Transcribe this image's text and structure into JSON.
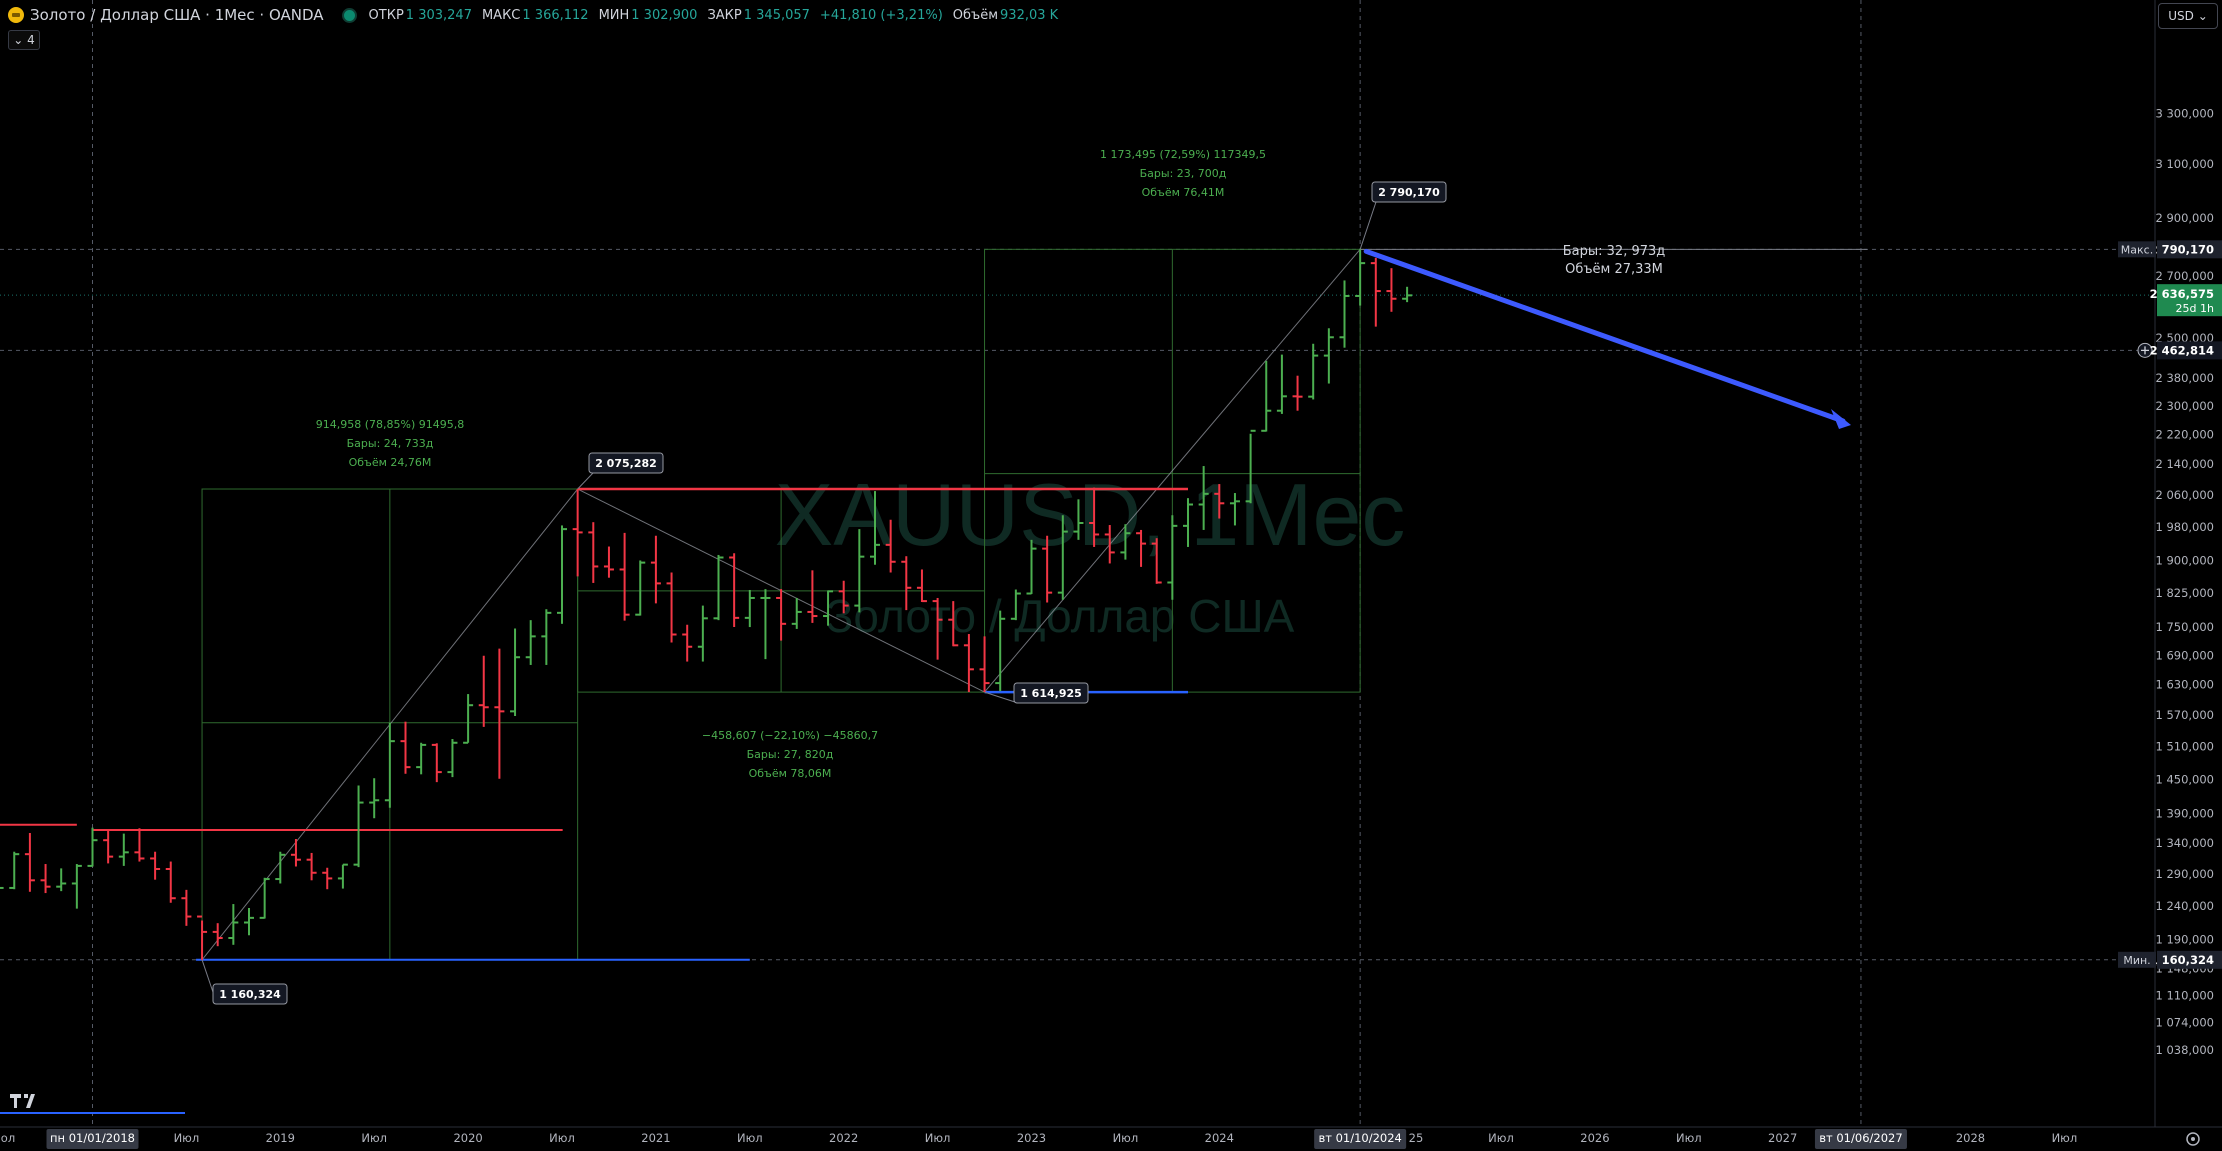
{
  "header": {
    "symbol_title": "Золото / Доллар США · 1Мес · OANDA",
    "open_label": "ОТКР",
    "open_value": "1 303,247",
    "high_label": "МАКС",
    "high_value": "1 366,112",
    "low_label": "МИН",
    "low_value": "1 302,900",
    "close_label": "ЗАКР",
    "close_value": "1 345,057",
    "change_value": "+41,810 (+3,21%)",
    "volume_label": "Объём",
    "volume_value": "932,03 K",
    "collapse_label": "⌄ 4",
    "currency_label": "USD ⌄"
  },
  "watermark": {
    "symbol": "XAUUSD, 1Mес",
    "name": "Золото / Доллар США"
  },
  "colors": {
    "up": "#26a69a",
    "up_bar": "#4caf50",
    "down": "#f23645",
    "arrow": "#3d5afe",
    "blue_line": "#2962ff",
    "range": "#2f6b2f"
  },
  "chart_data": {
    "type": "ohlc",
    "title": "Золото / Доллар США · 1Мес · OANDA",
    "xlabel": "",
    "ylabel": "",
    "ylim": [
      1038,
      3400
    ],
    "y_scale": "log",
    "y_ticks": [
      "3 300,000",
      "3 100,000",
      "2 900,000",
      "2 700,000",
      "2 500,000",
      "2 380,000",
      "2 300,000",
      "2 220,000",
      "2 140,000",
      "2 060,000",
      "1 980,000",
      "1 900,000",
      "1 825,000",
      "1 750,000",
      "1 690,000",
      "1 630,000",
      "1 570,000",
      "1 510,000",
      "1 450,000",
      "1 390,000",
      "1 340,000",
      "1 290,000",
      "1 240,000",
      "1 190,000",
      "1 148,000",
      "1 110,000",
      "1 074,000",
      "1 038,000"
    ],
    "y_tick_values": [
      3300,
      3100,
      2900,
      2700,
      2500,
      2380,
      2300,
      2220,
      2140,
      2060,
      1980,
      1900,
      1825,
      1750,
      1690,
      1630,
      1570,
      1510,
      1450,
      1390,
      1340,
      1290,
      1240,
      1190,
      1148,
      1110,
      1074,
      1038
    ],
    "x_labels": [
      {
        "label": "пн 01/01/2018",
        "date": "2018-01",
        "highlight": true
      },
      {
        "label": "Июл",
        "date": "2018-07"
      },
      {
        "label": "2019",
        "date": "2019-01"
      },
      {
        "label": "Июл",
        "date": "2019-07"
      },
      {
        "label": "2020",
        "date": "2020-01"
      },
      {
        "label": "Июл",
        "date": "2020-07"
      },
      {
        "label": "2021",
        "date": "2021-01"
      },
      {
        "label": "Июл",
        "date": "2021-07"
      },
      {
        "label": "2022",
        "date": "2022-01"
      },
      {
        "label": "Июл",
        "date": "2022-07"
      },
      {
        "label": "2023",
        "date": "2023-01"
      },
      {
        "label": "Июл",
        "date": "2023-07"
      },
      {
        "label": "2024",
        "date": "2024-01"
      },
      {
        "label": "вт 01/10/2024",
        "date": "2024-10",
        "highlight": true
      },
      {
        "label": "Июл",
        "date": "2025-07"
      },
      {
        "label": "2026",
        "date": "2026-01"
      },
      {
        "label": "Июл",
        "date": "2026-07"
      },
      {
        "label": "2027",
        "date": "2027-01"
      },
      {
        "label": "вт 01/06/2027",
        "date": "2027-06",
        "highlight": true
      },
      {
        "label": "2028",
        "date": "2028-01"
      },
      {
        "label": "Июл",
        "date": "2028-07"
      }
    ],
    "price_labels": [
      {
        "tag": "Макс.",
        "value": "2 790,170",
        "price": 2790.17,
        "style": "max"
      },
      {
        "tag": "",
        "value": "2 636,575",
        "sub": "25d 1h",
        "price": 2636.575,
        "style": "last"
      },
      {
        "tag": "",
        "value": "2 462,814",
        "price": 2462.814,
        "style": "cross"
      },
      {
        "tag": "Мин.",
        "value": "1 160,324",
        "price": 1160.324,
        "style": "min"
      }
    ],
    "point_labels": [
      {
        "text": "2 790,170",
        "date": "2024-10",
        "price": 2790.17
      },
      {
        "text": "2 075,282",
        "date": "2020-08",
        "price": 2075.282
      },
      {
        "text": "1 614,925",
        "date": "2022-10",
        "price": 1614.925
      },
      {
        "text": "1 160,324",
        "date": "2018-08",
        "price": 1160.324
      }
    ],
    "range_annotations": [
      {
        "lines": [
          "914,958 (78,85%) 91495,8",
          "Бары: 24, 733д",
          "Объём 24,76M"
        ]
      },
      {
        "lines": [
          "−458,607 (−22,10%) −45860,7",
          "Бары: 27, 820д",
          "Объём 78,06M"
        ]
      },
      {
        "lines": [
          "1 173,495 (72,59%) 117349,5",
          "Бары: 23, 700д",
          "Объём 76,41M"
        ]
      }
    ],
    "projection": {
      "lines": [
        "Бары: 32, 973д",
        "Объём 27,33M"
      ],
      "from": {
        "date": "2024-10",
        "price": 2790.17
      },
      "to": {
        "date": "2027-06",
        "price": 2220
      }
    },
    "candles": [
      {
        "d": "2017-05",
        "o": 1268,
        "h": 1300,
        "l": 1250,
        "c": 1270
      },
      {
        "d": "2017-06",
        "o": 1270,
        "h": 1297,
        "l": 1237,
        "c": 1242
      },
      {
        "d": "2017-07",
        "o": 1242,
        "h": 1275,
        "l": 1205,
        "c": 1268
      },
      {
        "d": "2017-08",
        "o": 1268,
        "h": 1326,
        "l": 1266,
        "c": 1322
      },
      {
        "d": "2017-09",
        "o": 1322,
        "h": 1357,
        "l": 1262,
        "c": 1280
      },
      {
        "d": "2017-10",
        "o": 1280,
        "h": 1306,
        "l": 1260,
        "c": 1270
      },
      {
        "d": "2017-11",
        "o": 1270,
        "h": 1299,
        "l": 1263,
        "c": 1275
      },
      {
        "d": "2017-12",
        "o": 1275,
        "h": 1306,
        "l": 1236,
        "c": 1303
      },
      {
        "d": "2018-01",
        "o": 1303,
        "h": 1366,
        "l": 1302,
        "c": 1345
      },
      {
        "d": "2018-02",
        "o": 1345,
        "h": 1361,
        "l": 1307,
        "c": 1318
      },
      {
        "d": "2018-03",
        "o": 1318,
        "h": 1356,
        "l": 1303,
        "c": 1325
      },
      {
        "d": "2018-04",
        "o": 1325,
        "h": 1365,
        "l": 1310,
        "c": 1315
      },
      {
        "d": "2018-05",
        "o": 1315,
        "h": 1326,
        "l": 1281,
        "c": 1298
      },
      {
        "d": "2018-06",
        "o": 1298,
        "h": 1310,
        "l": 1245,
        "c": 1252
      },
      {
        "d": "2018-07",
        "o": 1252,
        "h": 1265,
        "l": 1210,
        "c": 1224
      },
      {
        "d": "2018-08",
        "o": 1224,
        "h": 1218,
        "l": 1160,
        "c": 1201
      },
      {
        "d": "2018-09",
        "o": 1201,
        "h": 1214,
        "l": 1180,
        "c": 1192
      },
      {
        "d": "2018-10",
        "o": 1192,
        "h": 1243,
        "l": 1182,
        "c": 1215
      },
      {
        "d": "2018-11",
        "o": 1215,
        "h": 1237,
        "l": 1196,
        "c": 1222
      },
      {
        "d": "2018-12",
        "o": 1222,
        "h": 1284,
        "l": 1221,
        "c": 1282
      },
      {
        "d": "2019-01",
        "o": 1282,
        "h": 1326,
        "l": 1275,
        "c": 1321
      },
      {
        "d": "2019-02",
        "o": 1321,
        "h": 1347,
        "l": 1302,
        "c": 1313
      },
      {
        "d": "2019-03",
        "o": 1313,
        "h": 1324,
        "l": 1280,
        "c": 1292
      },
      {
        "d": "2019-04",
        "o": 1292,
        "h": 1300,
        "l": 1266,
        "c": 1283
      },
      {
        "d": "2019-05",
        "o": 1283,
        "h": 1305,
        "l": 1267,
        "c": 1305
      },
      {
        "d": "2019-06",
        "o": 1305,
        "h": 1439,
        "l": 1301,
        "c": 1409
      },
      {
        "d": "2019-07",
        "o": 1409,
        "h": 1452,
        "l": 1382,
        "c": 1413
      },
      {
        "d": "2019-08",
        "o": 1413,
        "h": 1555,
        "l": 1400,
        "c": 1520
      },
      {
        "d": "2019-09",
        "o": 1520,
        "h": 1557,
        "l": 1460,
        "c": 1472
      },
      {
        "d": "2019-10",
        "o": 1472,
        "h": 1517,
        "l": 1459,
        "c": 1513
      },
      {
        "d": "2019-11",
        "o": 1513,
        "h": 1516,
        "l": 1445,
        "c": 1463
      },
      {
        "d": "2019-12",
        "o": 1463,
        "h": 1524,
        "l": 1454,
        "c": 1517
      },
      {
        "d": "2020-01",
        "o": 1517,
        "h": 1611,
        "l": 1517,
        "c": 1589
      },
      {
        "d": "2020-02",
        "o": 1589,
        "h": 1689,
        "l": 1547,
        "c": 1585
      },
      {
        "d": "2020-03",
        "o": 1585,
        "h": 1704,
        "l": 1451,
        "c": 1577
      },
      {
        "d": "2020-04",
        "o": 1577,
        "h": 1747,
        "l": 1568,
        "c": 1686
      },
      {
        "d": "2020-05",
        "o": 1686,
        "h": 1765,
        "l": 1670,
        "c": 1730
      },
      {
        "d": "2020-06",
        "o": 1730,
        "h": 1789,
        "l": 1670,
        "c": 1781
      },
      {
        "d": "2020-07",
        "o": 1781,
        "h": 1984,
        "l": 1757,
        "c": 1975
      },
      {
        "d": "2020-08",
        "o": 1975,
        "h": 2075,
        "l": 1863,
        "c": 1967
      },
      {
        "d": "2020-09",
        "o": 1967,
        "h": 1992,
        "l": 1848,
        "c": 1886
      },
      {
        "d": "2020-10",
        "o": 1886,
        "h": 1933,
        "l": 1860,
        "c": 1879
      },
      {
        "d": "2020-11",
        "o": 1879,
        "h": 1966,
        "l": 1764,
        "c": 1777
      },
      {
        "d": "2020-12",
        "o": 1777,
        "h": 1900,
        "l": 1775,
        "c": 1895
      },
      {
        "d": "2021-01",
        "o": 1895,
        "h": 1959,
        "l": 1802,
        "c": 1847
      },
      {
        "d": "2021-02",
        "o": 1847,
        "h": 1872,
        "l": 1717,
        "c": 1734
      },
      {
        "d": "2021-03",
        "o": 1734,
        "h": 1755,
        "l": 1677,
        "c": 1708
      },
      {
        "d": "2021-04",
        "o": 1708,
        "h": 1797,
        "l": 1677,
        "c": 1769
      },
      {
        "d": "2021-05",
        "o": 1769,
        "h": 1913,
        "l": 1765,
        "c": 1907
      },
      {
        "d": "2021-06",
        "o": 1907,
        "h": 1917,
        "l": 1750,
        "c": 1770
      },
      {
        "d": "2021-07",
        "o": 1770,
        "h": 1832,
        "l": 1750,
        "c": 1814
      },
      {
        "d": "2021-08",
        "o": 1814,
        "h": 1834,
        "l": 1682,
        "c": 1814
      },
      {
        "d": "2021-09",
        "o": 1814,
        "h": 1834,
        "l": 1721,
        "c": 1757
      },
      {
        "d": "2021-10",
        "o": 1757,
        "h": 1814,
        "l": 1746,
        "c": 1783
      },
      {
        "d": "2021-11",
        "o": 1783,
        "h": 1877,
        "l": 1759,
        "c": 1774
      },
      {
        "d": "2021-12",
        "o": 1774,
        "h": 1831,
        "l": 1753,
        "c": 1829
      },
      {
        "d": "2022-01",
        "o": 1829,
        "h": 1853,
        "l": 1780,
        "c": 1797
      },
      {
        "d": "2022-02",
        "o": 1797,
        "h": 1975,
        "l": 1782,
        "c": 1909
      },
      {
        "d": "2022-03",
        "o": 1909,
        "h": 2070,
        "l": 1890,
        "c": 1937
      },
      {
        "d": "2022-04",
        "o": 1937,
        "h": 1998,
        "l": 1872,
        "c": 1897
      },
      {
        "d": "2022-05",
        "o": 1897,
        "h": 1910,
        "l": 1787,
        "c": 1837
      },
      {
        "d": "2022-06",
        "o": 1837,
        "h": 1879,
        "l": 1805,
        "c": 1807
      },
      {
        "d": "2022-07",
        "o": 1807,
        "h": 1814,
        "l": 1681,
        "c": 1766
      },
      {
        "d": "2022-08",
        "o": 1766,
        "h": 1807,
        "l": 1709,
        "c": 1711
      },
      {
        "d": "2022-09",
        "o": 1711,
        "h": 1735,
        "l": 1615,
        "c": 1661
      },
      {
        "d": "2022-10",
        "o": 1661,
        "h": 1730,
        "l": 1615,
        "c": 1633
      },
      {
        "d": "2022-11",
        "o": 1633,
        "h": 1786,
        "l": 1617,
        "c": 1768
      },
      {
        "d": "2022-12",
        "o": 1768,
        "h": 1833,
        "l": 1765,
        "c": 1824
      },
      {
        "d": "2023-01",
        "o": 1824,
        "h": 1949,
        "l": 1823,
        "c": 1928
      },
      {
        "d": "2023-02",
        "o": 1928,
        "h": 1959,
        "l": 1804,
        "c": 1826
      },
      {
        "d": "2023-03",
        "o": 1826,
        "h": 2009,
        "l": 1810,
        "c": 1969
      },
      {
        "d": "2023-04",
        "o": 1969,
        "h": 2049,
        "l": 1949,
        "c": 1990
      },
      {
        "d": "2023-05",
        "o": 1990,
        "h": 2079,
        "l": 1932,
        "c": 1962
      },
      {
        "d": "2023-06",
        "o": 1962,
        "h": 1985,
        "l": 1893,
        "c": 1919
      },
      {
        "d": "2023-07",
        "o": 1919,
        "h": 1987,
        "l": 1902,
        "c": 1965
      },
      {
        "d": "2023-08",
        "o": 1965,
        "h": 1973,
        "l": 1885,
        "c": 1940
      },
      {
        "d": "2023-09",
        "o": 1940,
        "h": 1953,
        "l": 1846,
        "c": 1849
      },
      {
        "d": "2023-10",
        "o": 1849,
        "h": 2009,
        "l": 1810,
        "c": 1983
      },
      {
        "d": "2023-11",
        "o": 1983,
        "h": 2052,
        "l": 1932,
        "c": 2036
      },
      {
        "d": "2023-12",
        "o": 2036,
        "h": 2135,
        "l": 1973,
        "c": 2063
      },
      {
        "d": "2024-01",
        "o": 2063,
        "h": 2088,
        "l": 2001,
        "c": 2039
      },
      {
        "d": "2024-02",
        "o": 2039,
        "h": 2065,
        "l": 1984,
        "c": 2044
      },
      {
        "d": "2024-03",
        "o": 2044,
        "h": 2222,
        "l": 2039,
        "c": 2230
      },
      {
        "d": "2024-04",
        "o": 2230,
        "h": 2431,
        "l": 2228,
        "c": 2286
      },
      {
        "d": "2024-05",
        "o": 2286,
        "h": 2450,
        "l": 2277,
        "c": 2327
      },
      {
        "d": "2024-06",
        "o": 2327,
        "h": 2387,
        "l": 2286,
        "c": 2326
      },
      {
        "d": "2024-07",
        "o": 2326,
        "h": 2483,
        "l": 2318,
        "c": 2447
      },
      {
        "d": "2024-08",
        "o": 2447,
        "h": 2531,
        "l": 2364,
        "c": 2503
      },
      {
        "d": "2024-09",
        "o": 2503,
        "h": 2685,
        "l": 2471,
        "c": 2634
      },
      {
        "d": "2024-10",
        "o": 2634,
        "h": 2790,
        "l": 2603,
        "c": 2743
      },
      {
        "d": "2024-11",
        "o": 2743,
        "h": 2761,
        "l": 2536,
        "c": 2650
      },
      {
        "d": "2024-12",
        "o": 2650,
        "h": 2726,
        "l": 2583,
        "c": 2625
      },
      {
        "d": "2025-01",
        "o": 2625,
        "h": 2664,
        "l": 2614,
        "c": 2636
      }
    ]
  }
}
